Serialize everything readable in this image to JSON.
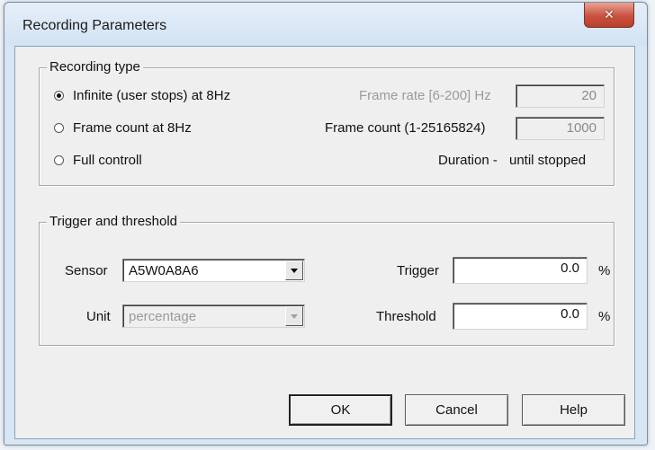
{
  "window": {
    "title": "Recording Parameters",
    "close_glyph": "✕"
  },
  "recording_type": {
    "label": "Recording type",
    "options": [
      {
        "label": "Infinite (user stops) at 8Hz",
        "checked": true
      },
      {
        "label": "Frame count at 8Hz",
        "checked": false
      },
      {
        "label": "Full controll",
        "checked": false
      }
    ],
    "frame_rate_label": "Frame rate [6-200] Hz",
    "frame_rate_value": "20",
    "frame_count_label": "Frame count (1-25165824)",
    "frame_count_value": "1000",
    "duration_label": "Duration -",
    "duration_value": "until stopped"
  },
  "trigger_threshold": {
    "label": "Trigger and threshold",
    "sensor_label": "Sensor",
    "sensor_value": "A5W0A8A6",
    "unit_label": "Unit",
    "unit_value": "percentage",
    "trigger_label": "Trigger",
    "trigger_value": "0.0",
    "threshold_label": "Threshold",
    "threshold_value": "0.0",
    "percent_symbol": "%"
  },
  "buttons": {
    "ok": "OK",
    "cancel": "Cancel",
    "help": "Help"
  }
}
